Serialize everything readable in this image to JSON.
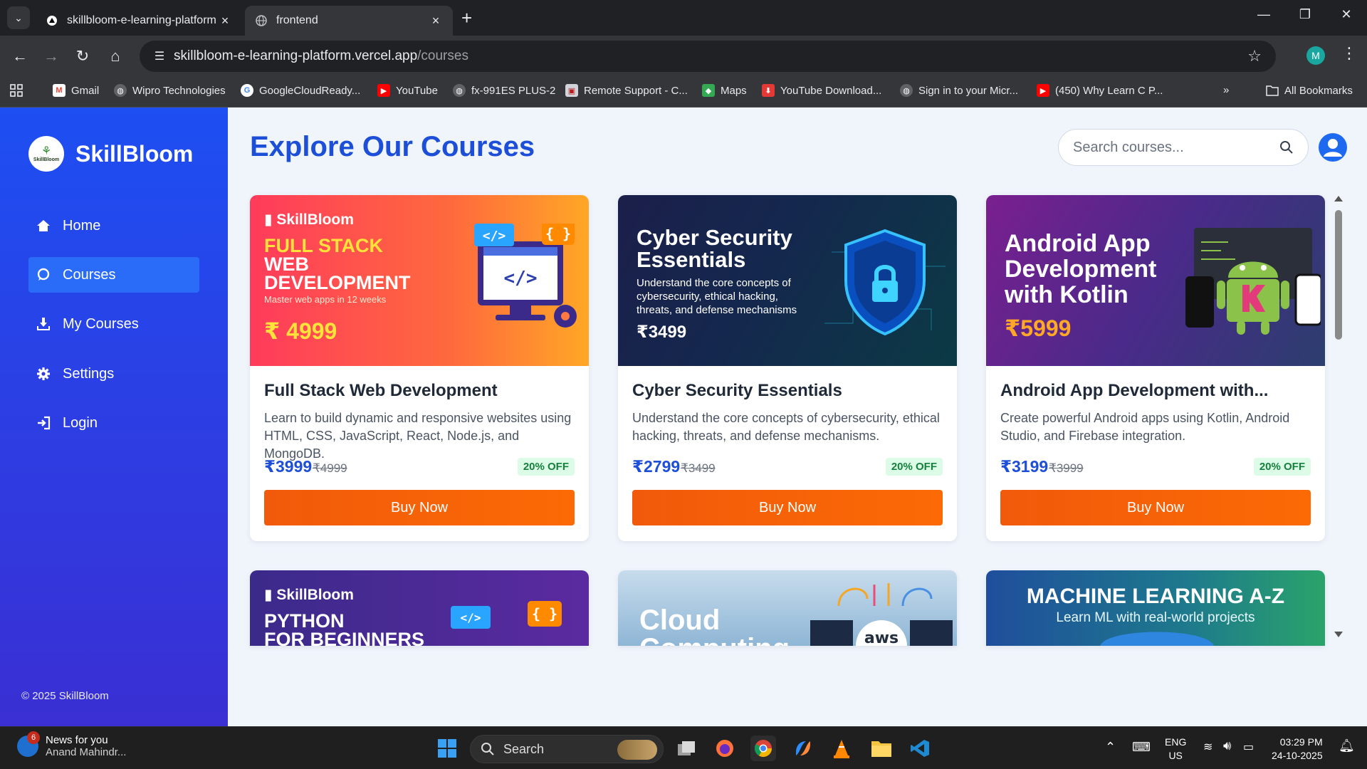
{
  "browser": {
    "tabs": [
      {
        "title": "skillbloom-e-learning-platform",
        "active": false
      },
      {
        "title": "frontend",
        "active": true
      }
    ],
    "url_host": "skillbloom-e-learning-platform.vercel.app",
    "url_path": "/courses",
    "profile_initial": "M",
    "bookmarks": [
      {
        "label": "Gmail",
        "icon": "gmail-icon"
      },
      {
        "label": "Wipro Technologies",
        "icon": "globe-icon"
      },
      {
        "label": "GoogleCloudReady...",
        "icon": "google-icon"
      },
      {
        "label": "YouTube",
        "icon": "youtube-icon"
      },
      {
        "label": "fx-991ES PLUS-2",
        "icon": "globe-icon"
      },
      {
        "label": "Remote Support - C...",
        "icon": "remote-icon"
      },
      {
        "label": "Maps",
        "icon": "maps-icon"
      },
      {
        "label": "YouTube Download...",
        "icon": "download-icon"
      },
      {
        "label": "Sign in to your Micr...",
        "icon": "globe-icon"
      },
      {
        "label": "(450) Why Learn C P...",
        "icon": "youtube-icon"
      }
    ],
    "all_bookmarks": "All Bookmarks"
  },
  "sidebar": {
    "brand": "SkillBloom",
    "logo_text": "SkillBloom",
    "items": [
      {
        "label": "Home",
        "icon": "home-icon",
        "active": false
      },
      {
        "label": "Courses",
        "icon": "chat-icon",
        "active": true
      },
      {
        "label": "My Courses",
        "icon": "download-icon",
        "active": false
      },
      {
        "label": "Settings",
        "icon": "gear-icon",
        "active": false
      },
      {
        "label": "Login",
        "icon": "login-icon",
        "active": false
      }
    ],
    "copyright": "© 2025 SkillBloom"
  },
  "main": {
    "title": "Explore Our Courses",
    "search_placeholder": "Search courses..."
  },
  "courses": [
    {
      "title": "Full Stack Web Development",
      "description": "Learn to build dynamic and responsive websites using HTML, CSS, JavaScript, React, Node.js, and MongoDB.",
      "price": "₹3999",
      "original_price": "₹4999",
      "discount": "20% OFF",
      "button": "Buy Now",
      "thumb": {
        "brand": "SkillBloom",
        "line1": "FULL STACK",
        "line2": "WEB",
        "line3": "DEVELOPMENT",
        "sub": "Master web apps in 12 weeks",
        "price": "₹ 4999"
      }
    },
    {
      "title": "Cyber Security Essentials",
      "description": "Understand the core concepts of cybersecurity, ethical hacking, threats, and defense mechanisms.",
      "price": "₹2799",
      "original_price": "₹3499",
      "discount": "20% OFF",
      "button": "Buy Now",
      "thumb": {
        "line1": "Cyber Security",
        "line2": "Essentials",
        "sub1": "Understand the core concepts of",
        "sub2": "cybersecurity, ethical hacking,",
        "sub3": "threats, and defense mechanisms",
        "price": "₹3499"
      }
    },
    {
      "title": "Android App Development with...",
      "description": "Create powerful Android apps using Kotlin, Android Studio, and Firebase integration.",
      "price": "₹3199",
      "original_price": "₹3999",
      "discount": "20% OFF",
      "button": "Buy Now",
      "thumb": {
        "line1": "Android App",
        "line2": "Development",
        "line3": "with Kotlin",
        "price": "₹5999"
      }
    }
  ],
  "next_row_thumbs": [
    {
      "brand": "SkillBloom",
      "line1": "PYTHON",
      "line2": "FOR BEGINNERS"
    },
    {
      "line1": "Cloud",
      "line2": "Computing",
      "badge": "aws"
    },
    {
      "line1": "MACHINE LEARNING A-Z",
      "line2": "Learn ML with real-world projects"
    }
  ],
  "taskbar": {
    "news_title": "News for you",
    "news_sub": "Anand Mahindr...",
    "news_badge": "6",
    "search_label": "Search",
    "lang1": "ENG",
    "lang2": "US",
    "time": "03:29 PM",
    "date": "24-10-2025"
  }
}
